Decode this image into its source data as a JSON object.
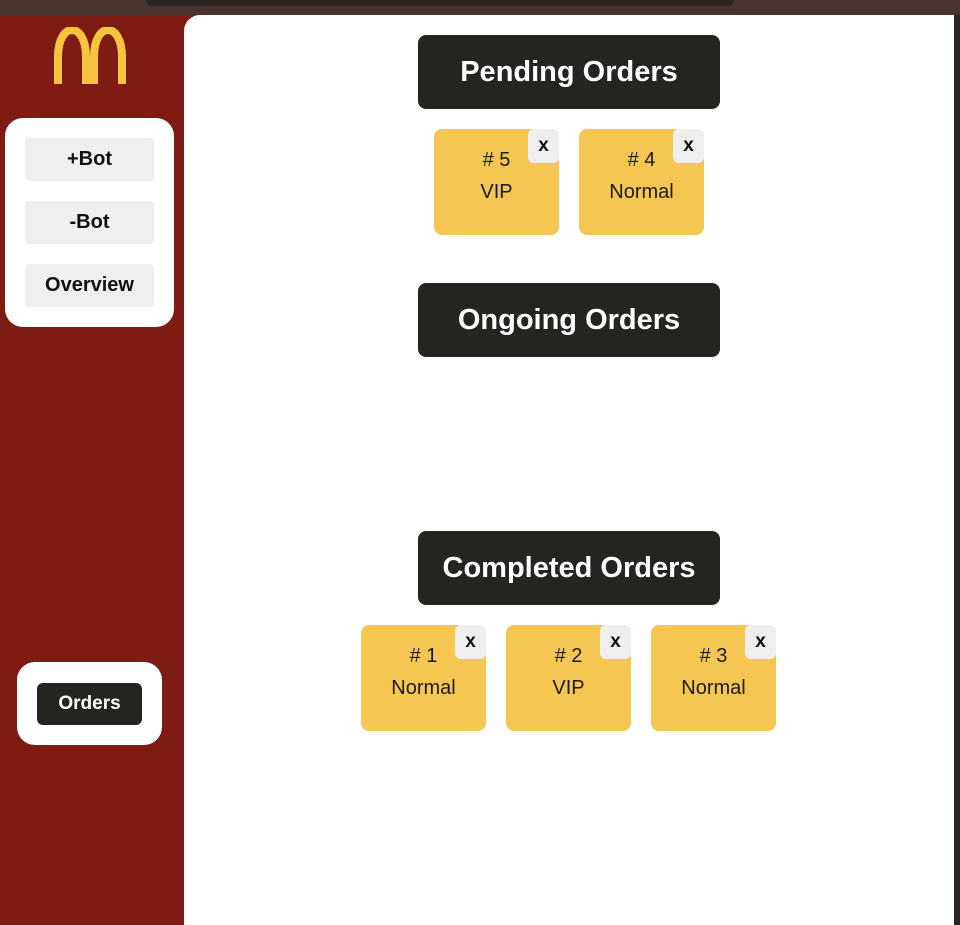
{
  "sidebar": {
    "logo_icon": "mcdonalds-golden-arches-logo",
    "actions": {
      "add_bot": "+Bot",
      "remove_bot": "-Bot",
      "overview": "Overview"
    },
    "nav": {
      "orders": "Orders"
    }
  },
  "sections": {
    "pending": {
      "title": "Pending Orders",
      "orders": [
        {
          "number": "# 5",
          "type": "VIP",
          "close": "x"
        },
        {
          "number": "# 4",
          "type": "Normal",
          "close": "x"
        }
      ]
    },
    "ongoing": {
      "title": "Ongoing Orders",
      "orders": []
    },
    "completed": {
      "title": "Completed Orders",
      "orders": [
        {
          "number": "# 1",
          "type": "Normal",
          "close": "x"
        },
        {
          "number": "# 2",
          "type": "VIP",
          "close": "x"
        },
        {
          "number": "# 3",
          "type": "Normal",
          "close": "x"
        }
      ]
    }
  },
  "colors": {
    "sidebar_bg": "#7e1c14",
    "header_bg": "#262421",
    "card_bg": "#f5c752",
    "logo_gold": "#f7c43f"
  }
}
